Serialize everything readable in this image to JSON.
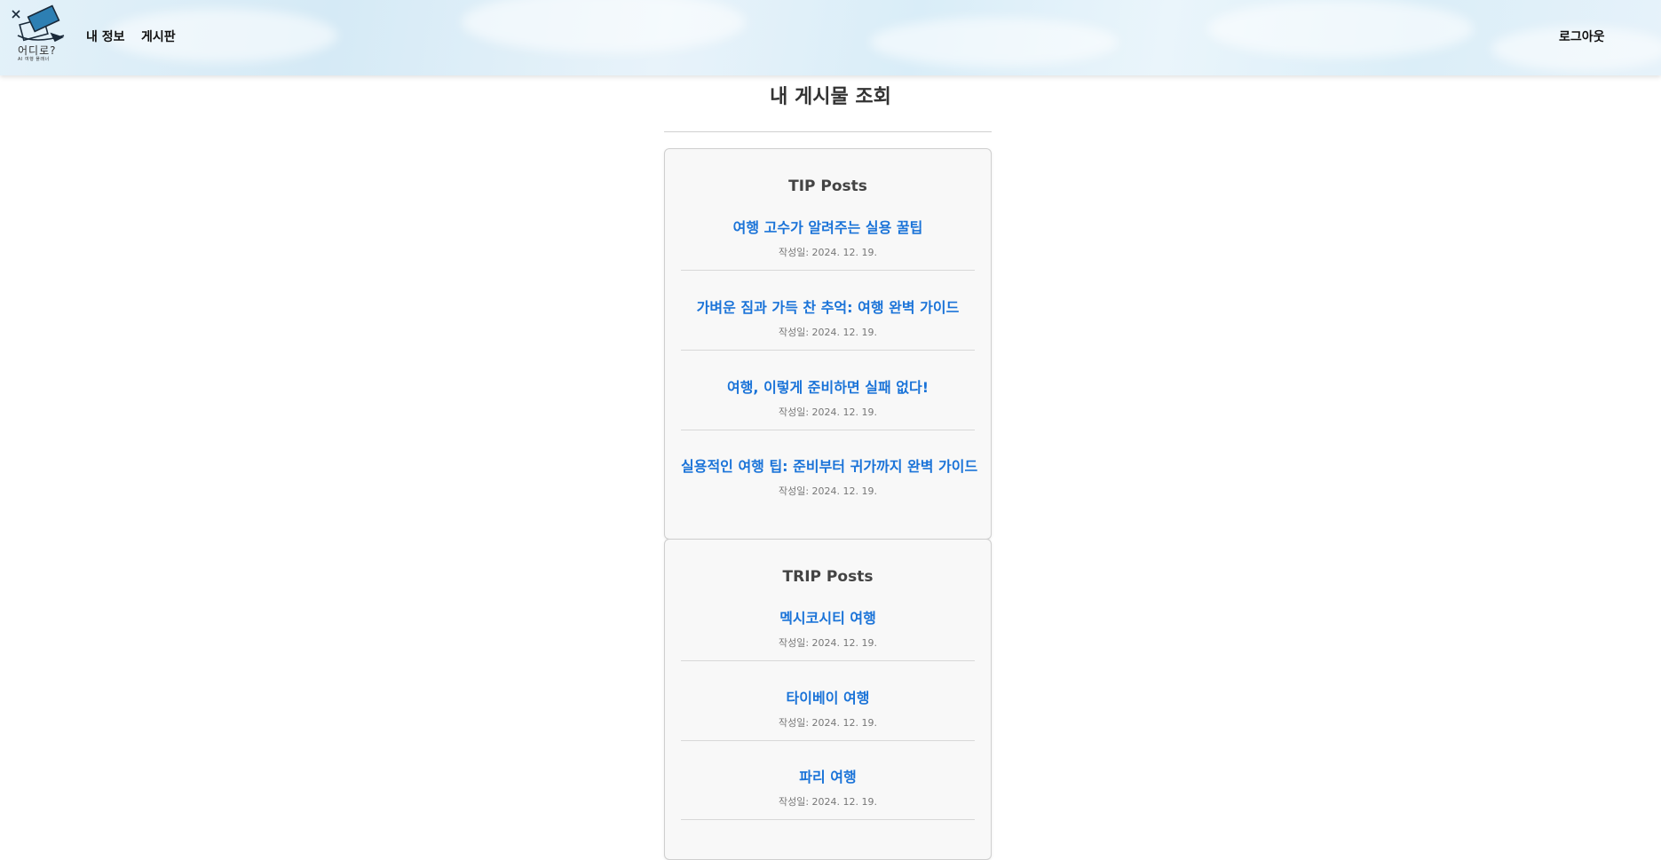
{
  "header": {
    "logo_text": "어디로?",
    "logo_sub": "AI 여행 플래너",
    "nav": {
      "my_info": "내 정보",
      "board": "게시판",
      "logout": "로그아웃"
    }
  },
  "page": {
    "title": "내 게시물 조회"
  },
  "tip_section": {
    "heading": "TIP Posts",
    "posts": [
      {
        "title": "여행 고수가 알려주는 실용 꿀팁",
        "date": "작성일: 2024. 12. 19."
      },
      {
        "title": "가벼운 짐과 가득 찬 추억: 여행 완벽 가이드",
        "date": "작성일: 2024. 12. 19."
      },
      {
        "title": "여행, 이렇게 준비하면 실패 없다!",
        "date": "작성일: 2024. 12. 19."
      },
      {
        "title": "실용적인 여행 팁: 준비부터 귀가까지 완벽 가이드",
        "date": "작성일: 2024. 12. 19."
      }
    ]
  },
  "trip_section": {
    "heading": "TRIP Posts",
    "posts": [
      {
        "title": "멕시코시티 여행",
        "date": "작성일: 2024. 12. 19."
      },
      {
        "title": "타이베이 여행",
        "date": "작성일: 2024. 12. 19."
      },
      {
        "title": "파리 여행",
        "date": "작성일: 2024. 12. 19."
      }
    ]
  },
  "colors": {
    "link": "#1a73d8",
    "header_bg": "#dceef8"
  },
  "icons": {
    "logo": "plane-ticket-logo-icon"
  }
}
